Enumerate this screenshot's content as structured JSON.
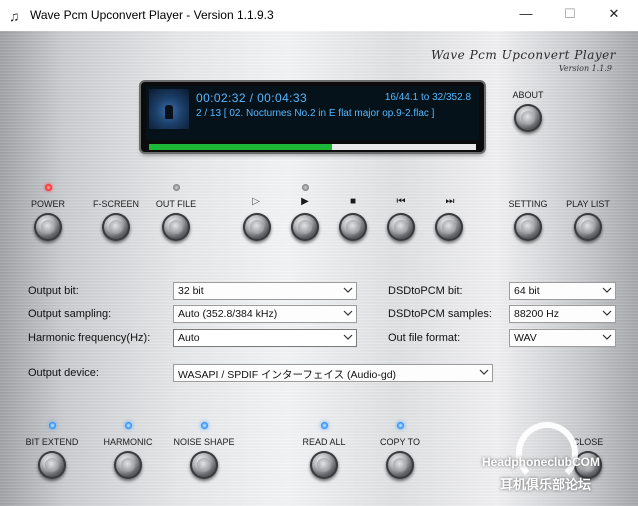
{
  "window": {
    "title": "Wave Pcm Upconvert Player - Version 1.1.9.3",
    "minimize": "—",
    "maximize": "☐",
    "close": "✕"
  },
  "brand": {
    "name": "Wave Pcm Upconvert Player",
    "version": "Version 1.1.9"
  },
  "display": {
    "time": "00:02:32 / 00:04:33",
    "track": "2 / 13  [ 02. Nocturnes No.2 in E flat major op.9-2.flac ]",
    "rate": "16/44.1 to 32/352.8",
    "progress_fraction": 0.56
  },
  "top_buttons": {
    "about": "ABOUT",
    "power": "POWER",
    "fscreen": "F-SCREEN",
    "outfile": "OUT FILE",
    "setting": "SETTING",
    "playlist": "PLAY LIST"
  },
  "transport": {
    "play_pause": "▷",
    "play": "▶",
    "stop": "■",
    "prev": "⏮",
    "next": "⏭"
  },
  "settings": {
    "output_bit_label": "Output bit:",
    "output_bit_value": "32 bit",
    "output_sampling_label": "Output sampling:",
    "output_sampling_value": "Auto (352.8/384 kHz)",
    "harmonic_label": "Harmonic frequency(Hz):",
    "harmonic_value": "Auto",
    "dsd_bit_label": "DSDtoPCM bit:",
    "dsd_bit_value": "64 bit",
    "dsd_samples_label": "DSDtoPCM samples:",
    "dsd_samples_value": "88200 Hz",
    "out_format_label": "Out file format:",
    "out_format_value": "WAV",
    "device_label": "Output device:",
    "device_value": "WASAPI / SPDIF インターフェイス (Audio-gd)"
  },
  "bottom_buttons": {
    "bit_extend": "BIT EXTEND",
    "harmonic": "HARMONIC",
    "noise_shape": "NOISE SHAPE",
    "read_all": "READ ALL",
    "copy_to": "COPY TO",
    "close": "CLOSE"
  },
  "watermark": {
    "line1": "HeadphoneclubCOM",
    "line2": "耳机俱乐部论坛"
  },
  "colors": {
    "display_text": "#57b8ff",
    "progress": "#1db838",
    "led_red": "#ff3030",
    "led_blue": "#3f9bff"
  }
}
